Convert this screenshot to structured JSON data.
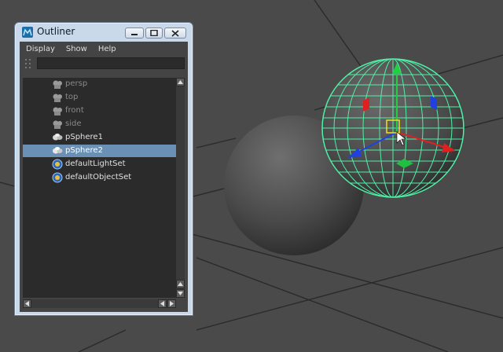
{
  "outliner": {
    "title": "Outliner",
    "menu": [
      "Display",
      "Show",
      "Help"
    ],
    "search_value": "",
    "items": [
      {
        "label": "persp",
        "icon": "camera-icon",
        "state": "dim"
      },
      {
        "label": "top",
        "icon": "camera-icon",
        "state": "dim"
      },
      {
        "label": "front",
        "icon": "camera-icon",
        "state": "dim"
      },
      {
        "label": "side",
        "icon": "camera-icon",
        "state": "dim"
      },
      {
        "label": "pSphere1",
        "icon": "mesh-icon",
        "state": "normal"
      },
      {
        "label": "pSphere2",
        "icon": "mesh-icon",
        "state": "selected"
      },
      {
        "label": "defaultLightSet",
        "icon": "set-icon",
        "state": "normal"
      },
      {
        "label": "defaultObjectSet",
        "icon": "set-icon",
        "state": "normal"
      }
    ]
  },
  "colors": {
    "viewport_bg": "#4a4a4a",
    "grid_line": "#2a2a2a",
    "wireframe": "#4ff0a6",
    "selection": "#6b90b6",
    "axis_x": "#e02020",
    "axis_y": "#20d040",
    "axis_z": "#2040e0",
    "pivot": "#f0e020"
  }
}
